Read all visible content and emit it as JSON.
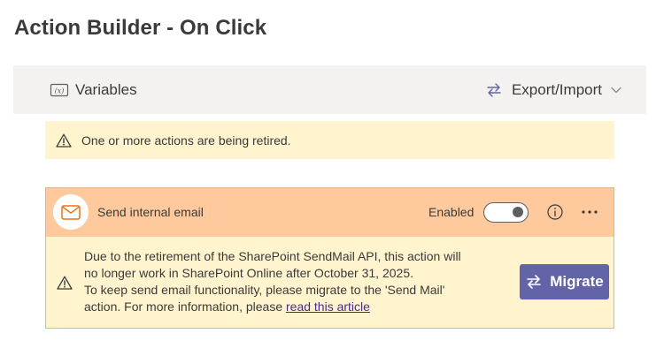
{
  "page": {
    "title": "Action Builder - On Click"
  },
  "toolbar": {
    "variables_label": "Variables",
    "variables_icon": "variable-icon",
    "export_label": "Export/Import",
    "export_icon": "swap-arrows-icon",
    "chevron_icon": "chevron-down-icon"
  },
  "banner": {
    "icon": "warning-icon",
    "text": "One or more actions are being retired."
  },
  "action": {
    "icon": "mail-icon",
    "title": "Send internal email",
    "enabled_label": "Enabled",
    "enabled": true,
    "info_icon": "info-icon",
    "more_icon": "more-options-icon",
    "warning": {
      "icon": "warning-icon",
      "line1": "Due to the retirement of the SharePoint SendMail API, this action will",
      "line2": "no longer work in SharePoint Online after October 31, 2025.",
      "line3": "To keep send email functionality, please migrate to the 'Send Mail'",
      "line4_prefix": "action. For more information, please ",
      "link_text": "read this article"
    },
    "migrate_button": {
      "label": "Migrate",
      "icon": "swap-arrows-icon"
    }
  },
  "colors": {
    "header_bg": "#ffc99e",
    "warning_bg": "#fff4ce",
    "toolbar_bg": "#f3f2f1",
    "primary_button": "#6264a7",
    "link": "#4b2a8a"
  }
}
